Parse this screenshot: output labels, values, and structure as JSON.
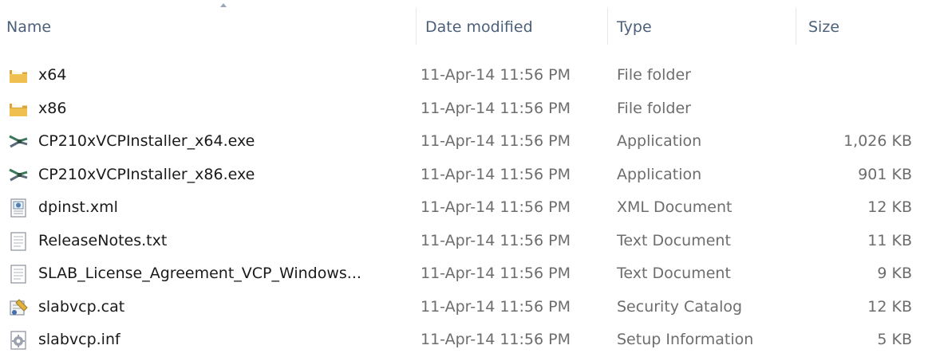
{
  "columns": {
    "name": "Name",
    "date": "Date modified",
    "type": "Type",
    "size": "Size"
  },
  "files": [
    {
      "name": "x64",
      "date": "11-Apr-14 11:56 PM",
      "type": "File folder",
      "size": "",
      "icon": "folder-icon"
    },
    {
      "name": "x86",
      "date": "11-Apr-14 11:56 PM",
      "type": "File folder",
      "size": "",
      "icon": "folder-icon"
    },
    {
      "name": "CP210xVCPInstaller_x64.exe",
      "date": "11-Apr-14 11:56 PM",
      "type": "Application",
      "size": "1,026 KB",
      "icon": "usb-installer-icon"
    },
    {
      "name": "CP210xVCPInstaller_x86.exe",
      "date": "11-Apr-14 11:56 PM",
      "type": "Application",
      "size": "901 KB",
      "icon": "usb-installer-icon"
    },
    {
      "name": "dpinst.xml",
      "date": "11-Apr-14 11:56 PM",
      "type": "XML Document",
      "size": "12 KB",
      "icon": "xml-document-icon"
    },
    {
      "name": "ReleaseNotes.txt",
      "date": "11-Apr-14 11:56 PM",
      "type": "Text Document",
      "size": "11 KB",
      "icon": "text-document-icon"
    },
    {
      "name": "SLAB_License_Agreement_VCP_Windows...",
      "date": "11-Apr-14 11:56 PM",
      "type": "Text Document",
      "size": "9 KB",
      "icon": "text-document-icon"
    },
    {
      "name": "slabvcp.cat",
      "date": "11-Apr-14 11:56 PM",
      "type": "Security Catalog",
      "size": "12 KB",
      "icon": "security-catalog-icon"
    },
    {
      "name": "slabvcp.inf",
      "date": "11-Apr-14 11:56 PM",
      "type": "Setup Information",
      "size": "5 KB",
      "icon": "setup-information-icon"
    }
  ],
  "colors": {
    "header_text": "#4c607a",
    "name_text": "#1a1a1a",
    "meta_text": "#6d6d6d",
    "folder": "#e8b64a"
  }
}
